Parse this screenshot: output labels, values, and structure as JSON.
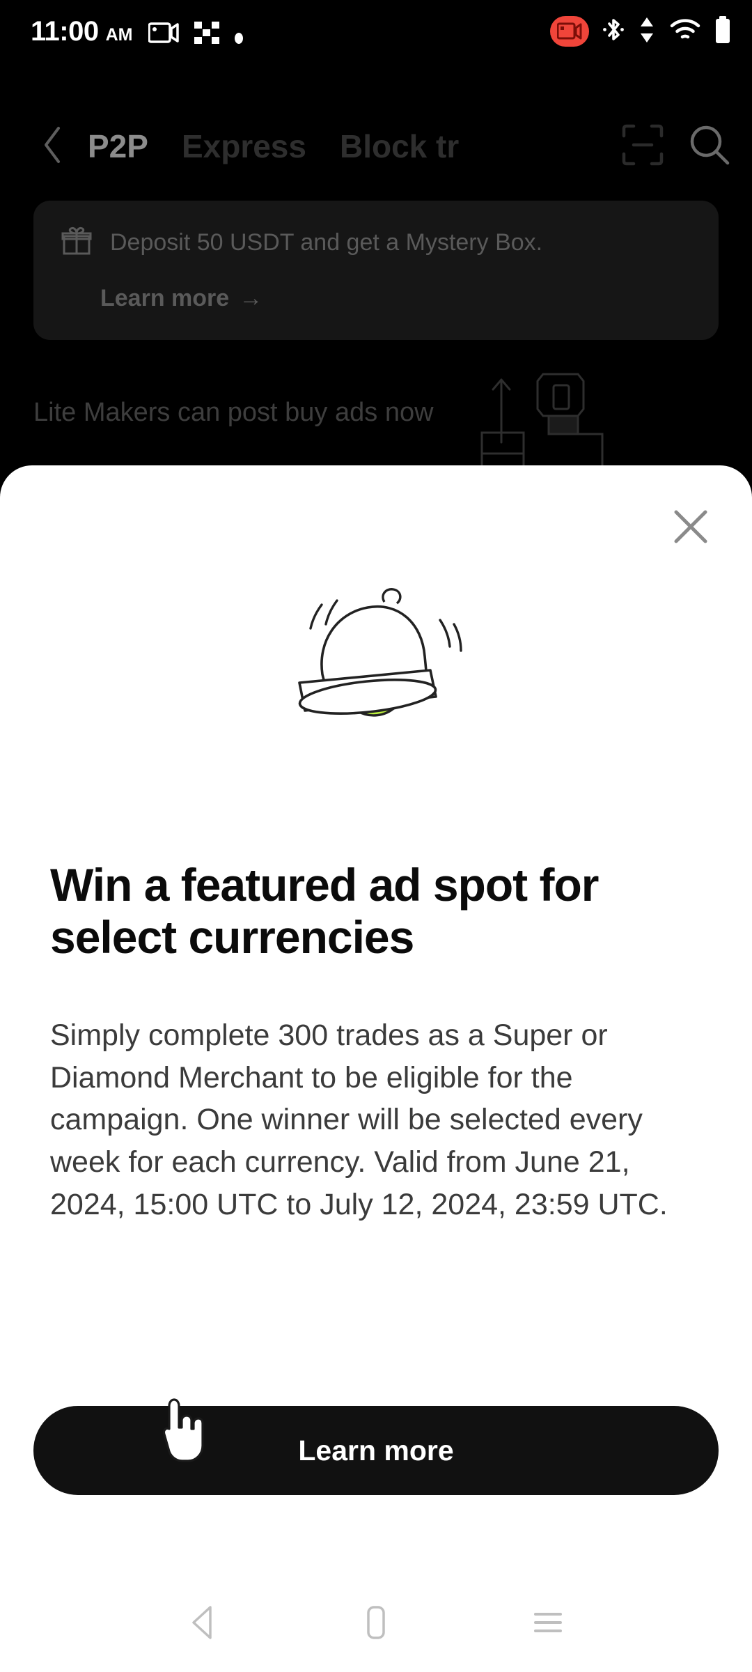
{
  "status_bar": {
    "time": "11:00",
    "meridiem": "AM",
    "icons": [
      "screen-record-icon",
      "qr-fragment-icon",
      "dot-icon"
    ],
    "right_icons": [
      "screen-record-badge-icon",
      "bluetooth-icon",
      "data-transfer-icon",
      "wifi-icon",
      "battery-icon"
    ],
    "record_badge_color": "#F0453A"
  },
  "top_nav": {
    "back_label": "back",
    "tabs": [
      {
        "label": "P2P",
        "active": true
      },
      {
        "label": "Express",
        "active": false
      },
      {
        "label": "Block tr",
        "active": false
      }
    ],
    "actions": [
      "scan-icon",
      "search-icon"
    ]
  },
  "promo_banner": {
    "icon": "gift-icon",
    "text": "Deposit 50 USDT and get a Mystery Box.",
    "link_label": "Learn more",
    "link_arrow": "→",
    "background": "#161616"
  },
  "lite_makers": {
    "text": "Lite Makers can post buy ads now",
    "illustration": "upload-ads-illustration"
  },
  "modal": {
    "close_icon": "close-icon",
    "illustration": "ringing-bell-illustration",
    "accent_color": "#BCF13C",
    "title": "Win a featured ad spot for select currencies",
    "body": "Simply complete 300 trades as a Super or Diamond Merchant to be eligible for the campaign. One winner will be selected every week for each currency. Valid from June 21, 2024, 15:00 UTC to July 12, 2024, 23:59 UTC.",
    "cta_label": "Learn more",
    "cta_color": "#111111",
    "cursor": "pointing-hand-cursor"
  },
  "system_nav": {
    "back": "back-triangle-icon",
    "home": "home-pill-icon",
    "recents": "recents-menu-icon"
  }
}
